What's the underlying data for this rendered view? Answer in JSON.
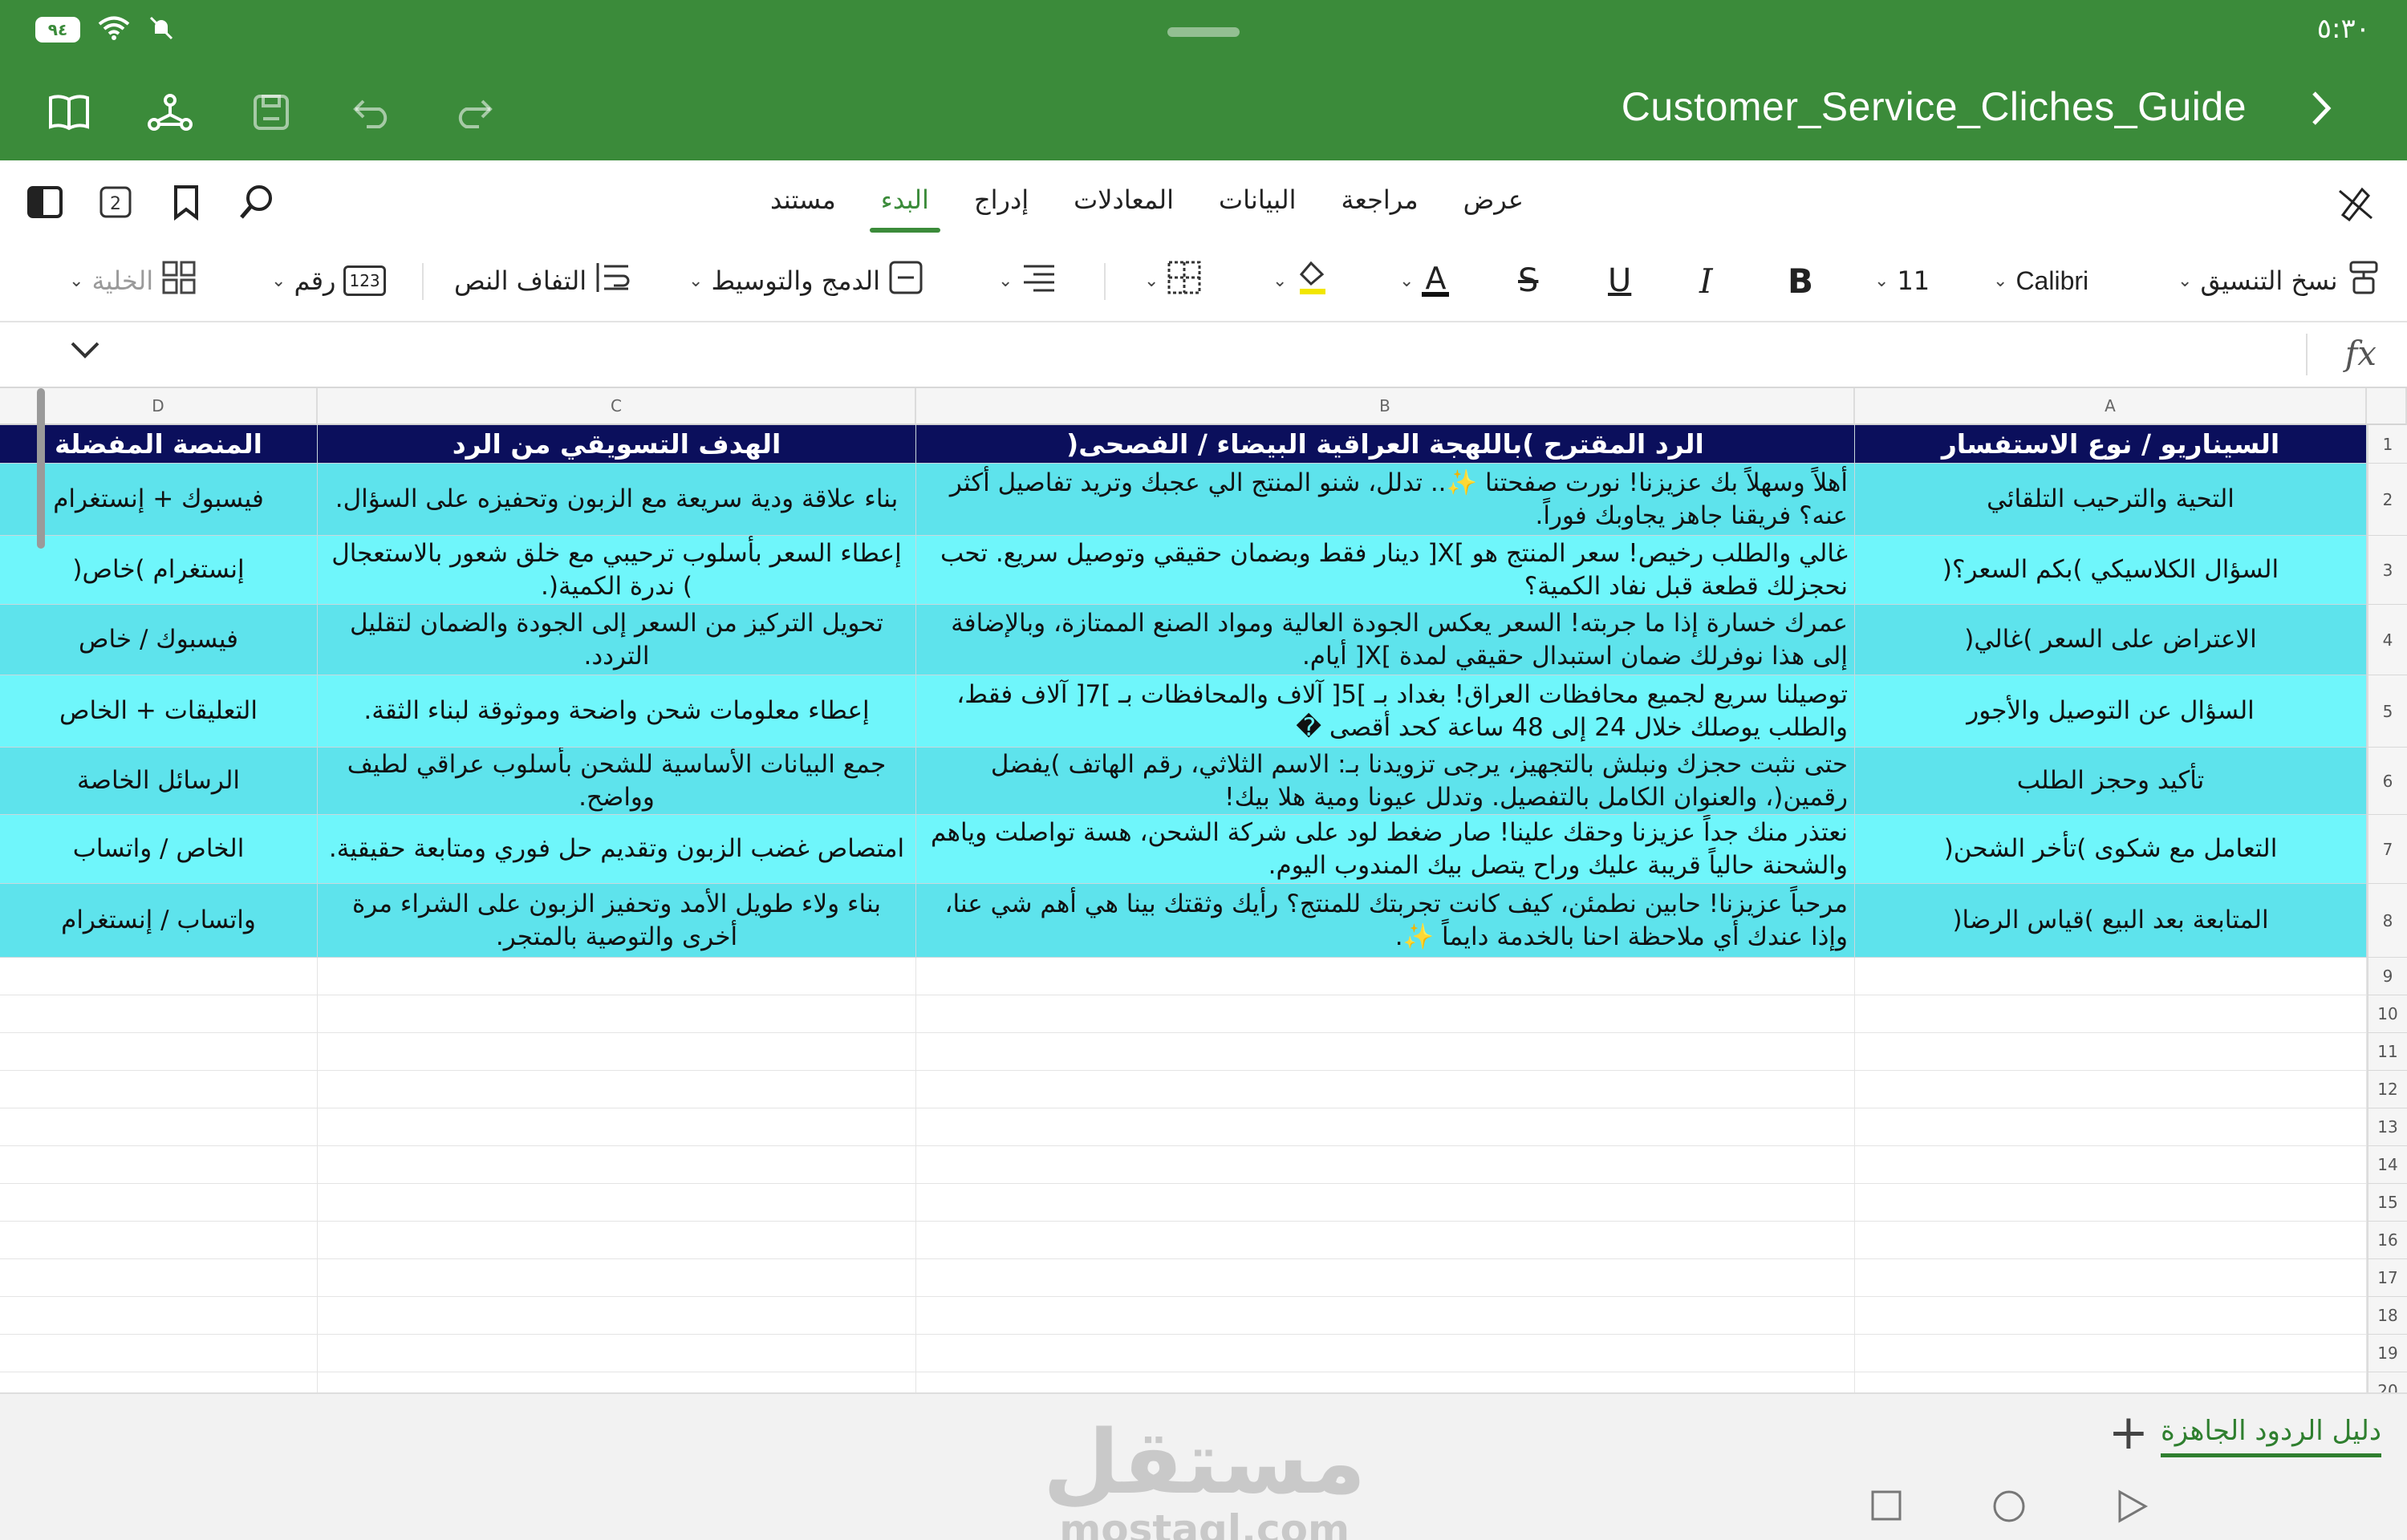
{
  "status": {
    "battery": "٩٤",
    "time": "٥:٣٠"
  },
  "title_bar": {
    "document_title": "Customer_Service_Cliches_Guide"
  },
  "ribbon": {
    "tabs": [
      {
        "label": "مستند",
        "active": false
      },
      {
        "label": "البدء",
        "active": true
      },
      {
        "label": "إدراج",
        "active": false
      },
      {
        "label": "المعادلات",
        "active": false
      },
      {
        "label": "البيانات",
        "active": false
      },
      {
        "label": "مراجعة",
        "active": false
      },
      {
        "label": "عرض",
        "active": false
      }
    ],
    "page_count_badge": "2"
  },
  "toolbar": {
    "format_painter": "نسخ التنسيق",
    "font_name": "Calibri",
    "font_size": "11",
    "bold": "B",
    "italic": "I",
    "underline": "U",
    "strike": "S",
    "font_color_glyph": "A",
    "merge_center": "الدمج والتوسيط",
    "wrap_text": "التفاف النص",
    "number_format": "رقم",
    "number_icon_text": "123",
    "cell": "الخلية"
  },
  "formula_bar": {
    "fx": "fx"
  },
  "columns": [
    "A",
    "B",
    "C",
    "D"
  ],
  "table": {
    "headers": [
      "السيناريو / نوع الاستفسار",
      "الرد المقترح )باللهجة العراقية البيضاء / الفصحى(",
      "الهدف التسويقي من الرد",
      "المنصة المفضلة"
    ],
    "rows": [
      [
        "التحية والترحيب التلقائي",
        "أهلاً وسهلاً بك عزيزنا! نورت صفحتنا ✨.. تدلل، شنو المنتج الي عجبك وتريد تفاصيل أكثر عنه؟ فريقنا جاهز يجاوبك فوراً.",
        "بناء علاقة ودية سريعة مع الزبون وتحفيزه على السؤال.",
        "فيسبوك + إنستغرام"
      ],
      [
        "السؤال الكلاسيكي )بكم السعر؟(",
        "غالي والطلب رخيص! سعر المنتج هو ]X[ دينار فقط وبضمان حقيقي وتوصيل سريع. تحب نحجزلك قطعة قبل نفاد الكمية؟",
        "إعطاء السعر بأسلوب ترحيبي مع خلق شعور بالاستعجال ) ندرة الكمية(.",
        "إنستغرام )خاص("
      ],
      [
        "الاعتراض على السعر )غالي(",
        "عمرك خسارة إذا ما جربته! السعر يعكس الجودة العالية ومواد الصنع الممتازة، وبالإضافة إلى هذا نوفرلك ضمان استبدال حقيقي لمدة ]X[ أيام.",
        "تحويل التركيز من السعر إلى الجودة والضمان لتقليل التردد.",
        "فيسبوك / خاص"
      ],
      [
        "السؤال عن التوصيل والأجور",
        "توصيلنا سريع لجميع محافظات العراق! بغداد بـ ]5[ آلاف والمحافظات بـ ]7[ آلاف فقط، والطلب يوصلك خلال 24 إلى 48 ساعة كحد أقصى �",
        "إعطاء معلومات شحن واضحة وموثوقة لبناء الثقة.",
        "التعليقات + الخاص"
      ],
      [
        "تأكيد وحجز الطلب",
        "حتى نثبت حجزك ونبلش بالتجهيز، يرجى تزويدنا بـ: الاسم الثلاثي، رقم الهاتف )يفضل رقمين(، والعنوان الكامل بالتفصيل. وتدلل عيونا ومية هلا بيك!",
        "جمع البيانات الأساسية للشحن بأسلوب عراقي لطيف وواضح.",
        "الرسائل الخاصة"
      ],
      [
        "التعامل مع شكوى )تأخر الشحن(",
        "نعتذر منك جداً عزيزنا وحقك علينا! صار ضغط لود على شركة الشحن، هسة تواصلت وياهم والشحنة حالياً قريبة عليك وراح يتصل بيك المندوب اليوم.",
        "امتصاص غضب الزبون وتقديم حل فوري ومتابعة حقيقية.",
        "الخاص / واتساب"
      ],
      [
        "المتابعة بعد البيع )قياس الرضا(",
        "مرحباً عزيزنا! حابين نطمئن، كيف كانت تجربتك للمنتج؟ رأيك وثقتك بينا هي أهم شي عنا، وإذا عندك أي ملاحظة احنا بالخدمة دايماً ✨.",
        "بناء ولاء طويل الأمد وتحفيز الزبون على الشراء مرة أخرى والتوصية بالمتجر.",
        "واتساب / إنستغرام"
      ]
    ],
    "row_numbers": [
      "1",
      "2",
      "3",
      "4",
      "5",
      "6",
      "7",
      "8",
      "9",
      "10",
      "11",
      "12",
      "13",
      "14",
      "15",
      "16",
      "17",
      "18",
      "19",
      "20"
    ]
  },
  "sheets": {
    "active_sheet": "دليل الردود الجاهزة",
    "add_label": "+"
  },
  "watermark": {
    "arabic": "مستقل",
    "latin": "mostaql.com"
  },
  "colors": {
    "brand_green": "#3b8b3a",
    "header_navy": "#0b0f5c",
    "row_a": "#5ee3ec",
    "row_b": "#6ff6fb"
  }
}
